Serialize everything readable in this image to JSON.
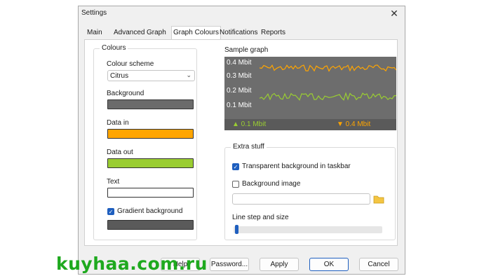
{
  "window": {
    "title": "Settings"
  },
  "tabs": [
    {
      "label": "Main"
    },
    {
      "label": "Advanced"
    },
    {
      "label": "Graph"
    },
    {
      "label": "Graph Colours"
    },
    {
      "label": "Notifications"
    },
    {
      "label": "Reports"
    }
  ],
  "colours": {
    "group_title": "Colours",
    "scheme_label": "Colour scheme",
    "scheme_value": "Citrus",
    "background_label": "Background",
    "background_color": "#6b6b6b",
    "data_in_label": "Data in",
    "data_in_color": "#ffa500",
    "data_out_label": "Data out",
    "data_out_color": "#9acd32",
    "text_label": "Text",
    "text_color": "#ffffff",
    "gradient_label": "Gradient background",
    "gradient_checked": true,
    "gradient_color": "#5a5a5a"
  },
  "sample_graph": {
    "title": "Sample graph",
    "y_labels": [
      "0.4 Mbit",
      "0.3 Mbit",
      "0.2 Mbit",
      "0.1 Mbit"
    ],
    "in_label": "▲ 0.1 Mbit",
    "out_label": "▼ 0.4 Mbit"
  },
  "extra": {
    "group_title": "Extra stuff",
    "transparent_label": "Transparent background in taskbar",
    "transparent_checked": true,
    "bgimage_label": "Background image",
    "bgimage_checked": false,
    "bgimage_path": "",
    "line_step_label": "Line step and size",
    "line_step_value": 0
  },
  "buttons": {
    "help": "Help",
    "password": "Password...",
    "apply": "Apply",
    "ok": "OK",
    "cancel": "Cancel"
  },
  "watermark": "kuyhaa.com.ru",
  "icons": {
    "close": "close-icon",
    "chevron": "chevron-down-icon",
    "folder": "folder-icon",
    "checkmark": "checkmark-icon"
  }
}
